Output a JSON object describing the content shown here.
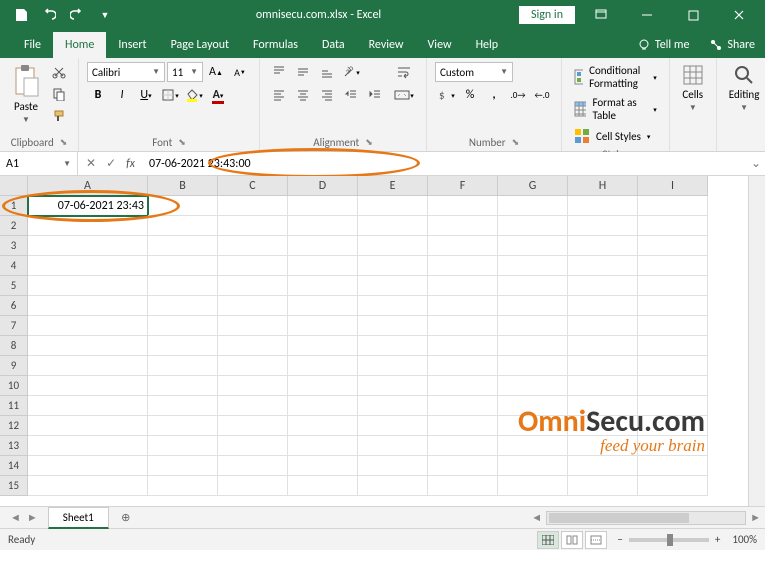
{
  "titlebar": {
    "doc_title": "omnisecu.com.xlsx - Excel",
    "signin_label": "Sign in"
  },
  "tabs": {
    "file": "File",
    "home": "Home",
    "insert": "Insert",
    "page_layout": "Page Layout",
    "formulas": "Formulas",
    "data": "Data",
    "review": "Review",
    "view": "View",
    "help": "Help",
    "tell_me": "Tell me",
    "share": "Share"
  },
  "ribbon": {
    "clipboard": {
      "label": "Clipboard",
      "paste": "Paste"
    },
    "font": {
      "label": "Font",
      "name": "Calibri",
      "size": "11"
    },
    "alignment": {
      "label": "Alignment"
    },
    "number": {
      "label": "Number",
      "format": "Custom"
    },
    "styles": {
      "label": "Styles",
      "conditional": "Conditional Formatting",
      "table": "Format as Table",
      "cell": "Cell Styles"
    },
    "cells": {
      "label": "Cells"
    },
    "editing": {
      "label": "Editing"
    }
  },
  "formula_bar": {
    "name_box": "A1",
    "fx": "fx",
    "value": "07-06-2021  23:43:00"
  },
  "grid": {
    "columns": [
      "A",
      "B",
      "C",
      "D",
      "E",
      "F",
      "G",
      "H",
      "I"
    ],
    "rows": [
      1,
      2,
      3,
      4,
      5,
      6,
      7,
      8,
      9,
      10,
      11,
      12,
      13,
      14,
      15
    ],
    "a1_value": "07-06-2021 23:43"
  },
  "sheet_tabs": {
    "sheet1": "Sheet1"
  },
  "statusbar": {
    "ready": "Ready",
    "zoom": "100%"
  },
  "watermark": {
    "brand1": "Omni",
    "brand2": "Secu",
    "brand3": ".com",
    "slogan": "feed your brain"
  }
}
